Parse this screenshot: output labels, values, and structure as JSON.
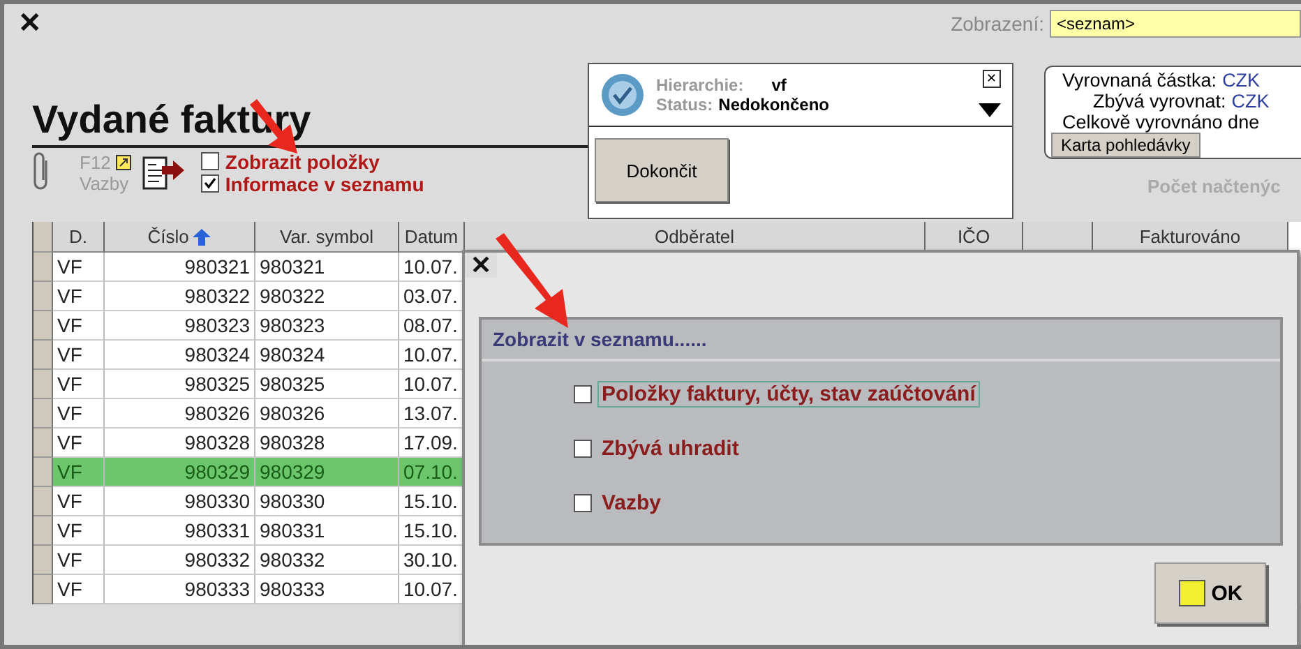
{
  "window": {
    "close": "✕"
  },
  "view": {
    "label": "Zobrazení:",
    "value": "<seznam>"
  },
  "title": "Vydané faktury",
  "toolbar": {
    "shortcut": "F12",
    "links_label": "Vazby",
    "options": [
      {
        "label": "Zobrazit položky",
        "checked": false
      },
      {
        "label": "Informace v seznamu",
        "checked": true
      }
    ]
  },
  "status_panel": {
    "hierarchy_label": "Hierarchie:",
    "hierarchy_value": "vf",
    "status_label": "Status:",
    "status_value": "Nedokončeno",
    "close": "✕",
    "finish_button": "Dokončit"
  },
  "balance_panel": {
    "lines": [
      {
        "label": "Vyrovnaná částka:",
        "value": "CZK"
      },
      {
        "label": "Zbývá vyrovnat:",
        "value": "CZK"
      },
      {
        "label": "Celkově vyrovnáno dne"
      }
    ],
    "button": "Karta pohledávky"
  },
  "loaded_count": "Počet načtenýc",
  "table": {
    "columns": [
      {
        "label": "D.",
        "sorted_ascending": false
      },
      {
        "label": "Číslo",
        "sorted_ascending": true
      },
      {
        "label": "Var. symbol",
        "sorted_ascending": false
      },
      {
        "label": "Datum",
        "sorted_ascending": false
      },
      {
        "label": "Odběratel",
        "sorted_ascending": false
      },
      {
        "label": "IČO",
        "sorted_ascending": false
      },
      {
        "sorted_ascending": false
      },
      {
        "label": "Fakturováno",
        "sorted_ascending": false
      }
    ],
    "rows": [
      {
        "d": "VF",
        "number": "980321",
        "symbol": "980321",
        "date": "10.07.",
        "selected": false
      },
      {
        "d": "VF",
        "number": "980322",
        "symbol": "980322",
        "date": "03.07.",
        "selected": false
      },
      {
        "d": "VF",
        "number": "980323",
        "symbol": "980323",
        "date": "08.07.",
        "selected": false
      },
      {
        "d": "VF",
        "number": "980324",
        "symbol": "980324",
        "date": "10.07.",
        "selected": false
      },
      {
        "d": "VF",
        "number": "980325",
        "symbol": "980325",
        "date": "10.07.",
        "selected": false
      },
      {
        "d": "VF",
        "number": "980326",
        "symbol": "980326",
        "date": "13.07.",
        "selected": false
      },
      {
        "d": "VF",
        "number": "980328",
        "symbol": "980328",
        "date": "17.09.",
        "selected": false
      },
      {
        "d": "VF",
        "number": "980329",
        "symbol": "980329",
        "date": "07.10.",
        "selected": true
      },
      {
        "d": "VF",
        "number": "980330",
        "symbol": "980330",
        "date": "15.10.",
        "selected": false
      },
      {
        "d": "VF",
        "number": "980331",
        "symbol": "980331",
        "date": "15.10.",
        "selected": false
      },
      {
        "d": "VF",
        "number": "980332",
        "symbol": "980332",
        "date": "30.10.",
        "selected": false
      },
      {
        "d": "VF",
        "number": "980333",
        "symbol": "980333",
        "date": "10.07.",
        "selected": false
      }
    ]
  },
  "dialog": {
    "close": "✕",
    "heading": "Zobrazit v seznamu......",
    "options": [
      {
        "label": "Položky faktury, účty, stav zaúčtování",
        "checked": false,
        "focused": true
      },
      {
        "label": "Zbývá uhradit",
        "checked": false,
        "focused": false
      },
      {
        "label": "Vazby",
        "checked": false,
        "focused": false
      }
    ],
    "ok_button": "OK"
  }
}
